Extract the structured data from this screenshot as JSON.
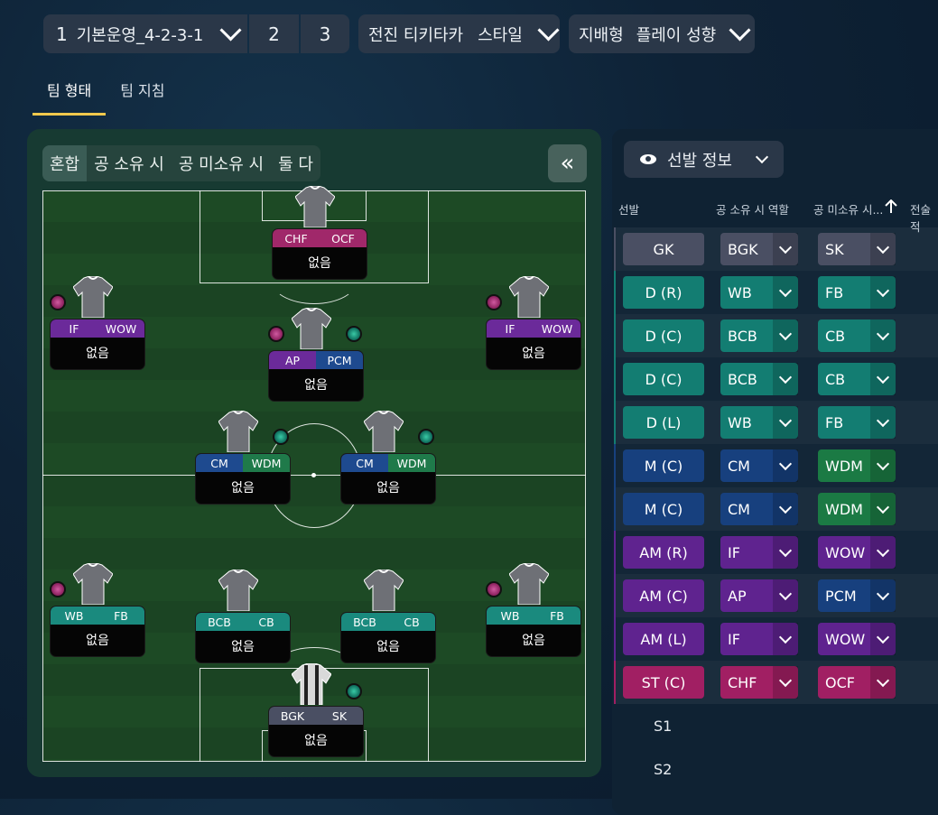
{
  "top": {
    "formation_num": "1",
    "formation_name": "기본운영_4-2-3-1",
    "slot2": "2",
    "slot3": "3",
    "style_prefix": "전진 티키타카",
    "style_label": "스타일",
    "play_prefix": "지배형",
    "play_label": "플레이 성향"
  },
  "tabs": [
    "팀 형태",
    "팀 지침"
  ],
  "viewtabs": [
    "혼합",
    "공 소유 시",
    "공 미소유 시",
    "둘 다"
  ],
  "collapse_icon": "«",
  "player_name": "없음",
  "players": [
    {
      "r1": "CHF",
      "r2": "OCF",
      "c1": "#a0286a",
      "c2": "#a0286a"
    },
    {
      "r1": "IF",
      "r2": "WOW",
      "c1": "#6b2a9a",
      "c2": "#6b2a9a"
    },
    {
      "r1": "AP",
      "r2": "PCM",
      "c1": "#6b2a9a",
      "c2": "#1e4a8f"
    },
    {
      "r1": "IF",
      "r2": "WOW",
      "c1": "#6b2a9a",
      "c2": "#6b2a9a"
    },
    {
      "r1": "CM",
      "r2": "WDM",
      "c1": "#1e4a8f",
      "c2": "#1f7a4a"
    },
    {
      "r1": "CM",
      "r2": "WDM",
      "c1": "#1e4a8f",
      "c2": "#1f7a4a"
    },
    {
      "r1": "WB",
      "r2": "FB",
      "c1": "#1a8a7e",
      "c2": "#1a8a7e"
    },
    {
      "r1": "BCB",
      "r2": "CB",
      "c1": "#1a8a7e",
      "c2": "#1a8a7e"
    },
    {
      "r1": "BCB",
      "r2": "CB",
      "c1": "#1a8a7e",
      "c2": "#1a8a7e"
    },
    {
      "r1": "WB",
      "r2": "FB",
      "c1": "#1a8a7e",
      "c2": "#1a8a7e"
    },
    {
      "r1": "BGK",
      "r2": "SK",
      "c1": "#4a4f63",
      "c2": "#4a4f63"
    }
  ],
  "lineup_button": "선발 정보",
  "columns": {
    "lineup": "선발",
    "in_poss": "공 소유 시 역할",
    "out_poss": "공 미소유 시...",
    "tactic": "전술적"
  },
  "rows": [
    {
      "pos": "GK",
      "pc": "#4a4f63",
      "a": "BGK",
      "ac": "#4a4f63",
      "b": "SK",
      "bc": "#4a4f63"
    },
    {
      "pos": "D (R)",
      "pc": "#137d72",
      "a": "WB",
      "ac": "#137d72",
      "b": "FB",
      "bc": "#137d72"
    },
    {
      "pos": "D (C)",
      "pc": "#137d72",
      "a": "BCB",
      "ac": "#137d72",
      "b": "CB",
      "bc": "#137d72"
    },
    {
      "pos": "D (C)",
      "pc": "#137d72",
      "a": "BCB",
      "ac": "#137d72",
      "b": "CB",
      "bc": "#137d72"
    },
    {
      "pos": "D (L)",
      "pc": "#137d72",
      "a": "WB",
      "ac": "#137d72",
      "b": "FB",
      "bc": "#137d72"
    },
    {
      "pos": "M (C)",
      "pc": "#17407e",
      "a": "CM",
      "ac": "#17407e",
      "b": "WDM",
      "bc": "#1b7a44"
    },
    {
      "pos": "M (C)",
      "pc": "#17407e",
      "a": "CM",
      "ac": "#17407e",
      "b": "WDM",
      "bc": "#1b7a44"
    },
    {
      "pos": "AM (R)",
      "pc": "#5f238f",
      "a": "IF",
      "ac": "#5f238f",
      "b": "WOW",
      "bc": "#5f238f"
    },
    {
      "pos": "AM (C)",
      "pc": "#5f238f",
      "a": "AP",
      "ac": "#5f238f",
      "b": "PCM",
      "bc": "#17407e"
    },
    {
      "pos": "AM (L)",
      "pc": "#5f238f",
      "a": "IF",
      "ac": "#5f238f",
      "b": "WOW",
      "bc": "#5f238f"
    },
    {
      "pos": "ST (C)",
      "pc": "#a11f63",
      "a": "CHF",
      "ac": "#a11f63",
      "b": "OCF",
      "bc": "#a11f63"
    }
  ],
  "subs": [
    "S1",
    "S2"
  ]
}
